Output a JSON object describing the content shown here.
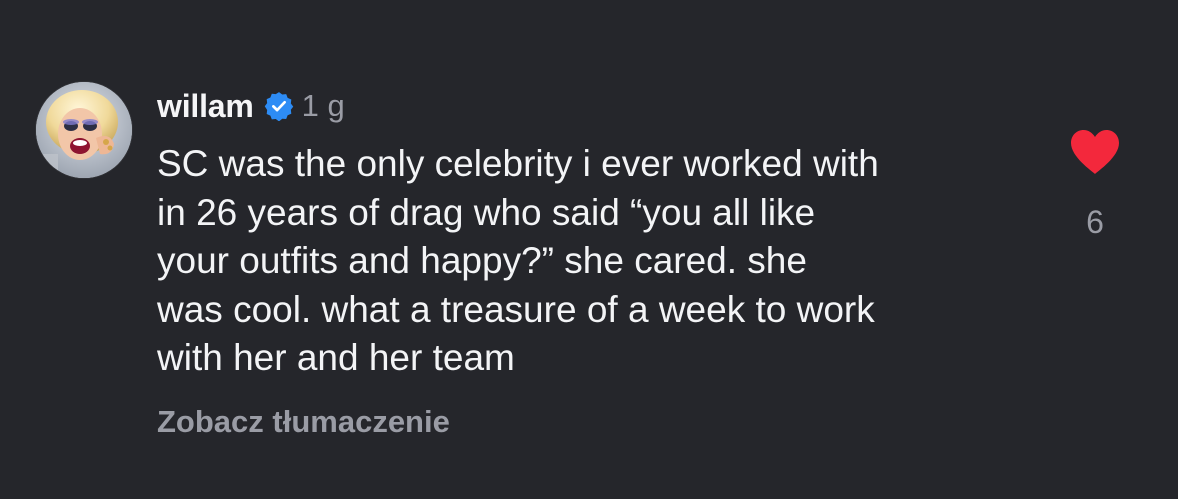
{
  "comment": {
    "username": "willam",
    "verified_icon": "verified-badge-icon",
    "timestamp": "1 g",
    "text_lines": [
      "SC was the only celebrity i ever worked with",
      "in 26 years of drag who said “you all like",
      "your outfits and happy?” she cared. she",
      "was cool. what a treasure of a week to work",
      "with her and her team"
    ],
    "translate_label": "Zobacz tłumaczenie",
    "like_icon": "heart-filled-icon",
    "like_count": "6"
  },
  "colors": {
    "background": "#25262b",
    "text_primary": "#f3f4f6",
    "text_secondary": "#9a9ca5",
    "verified_blue": "#2d8cf5",
    "like_red": "#f3283c"
  }
}
